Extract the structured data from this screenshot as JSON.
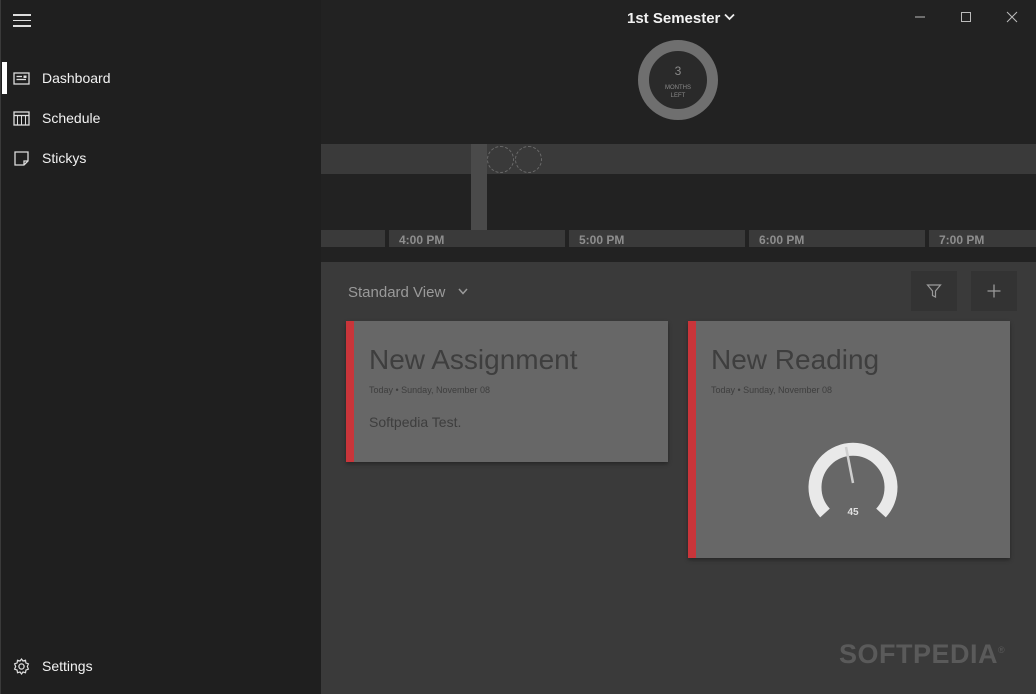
{
  "sidebar": {
    "items": [
      {
        "label": "Dashboard",
        "icon": "dashboard-icon",
        "active": true
      },
      {
        "label": "Schedule",
        "icon": "calendar-icon",
        "active": false
      },
      {
        "label": "Stickys",
        "icon": "sticky-note-icon",
        "active": false
      }
    ],
    "settings_label": "Settings"
  },
  "header": {
    "semester": "1st Semester",
    "countdown": {
      "value": "3",
      "label_line1": "MONTHS",
      "label_line2": "LEFT"
    }
  },
  "timeline": {
    "labels": [
      "4:00 PM",
      "5:00 PM",
      "6:00 PM",
      "7:00 PM"
    ]
  },
  "content": {
    "view_label": "Standard View",
    "cards": [
      {
        "title": "New Assignment",
        "date": "Today • Sunday, November 08",
        "note": "Softpedia Test."
      },
      {
        "title": "New Reading",
        "date": "Today • Sunday, November 08",
        "gauge_value": "45"
      }
    ]
  },
  "watermark": {
    "text": "SOFTPEDIA",
    "mark": "®"
  },
  "colors": {
    "accent": "#c9353a",
    "card": "#676767",
    "sidebar": "#1f1f1f",
    "content": "#3a3a3a"
  }
}
